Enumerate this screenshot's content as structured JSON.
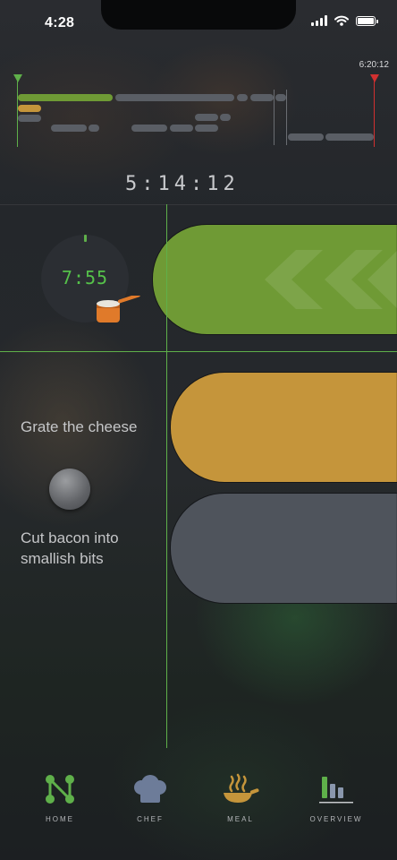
{
  "status_bar": {
    "time": "4:28"
  },
  "timeline": {
    "end_time": "6:20:12",
    "elapsed": "5:14:12",
    "colors": {
      "start_marker": "#5fb04a",
      "end_marker": "#d23030",
      "active": "#6f9a35",
      "ingredient": "#c5953b",
      "idle": "#5a5e65"
    }
  },
  "active_task": {
    "timer": "7:55",
    "icon": "saucepan-icon"
  },
  "tasks": [
    {
      "label": "Grate the cheese",
      "color": "#c5953b"
    },
    {
      "label": "Cut bacon into smallish bits",
      "color": "#4f545c"
    }
  ],
  "tabs": [
    {
      "label": "HOME",
      "icon": "home-network-icon"
    },
    {
      "label": "CHEF",
      "icon": "chef-hat-icon"
    },
    {
      "label": "MEAL",
      "icon": "pan-icon"
    },
    {
      "label": "OVERVIEW",
      "icon": "bar-chart-icon"
    }
  ]
}
